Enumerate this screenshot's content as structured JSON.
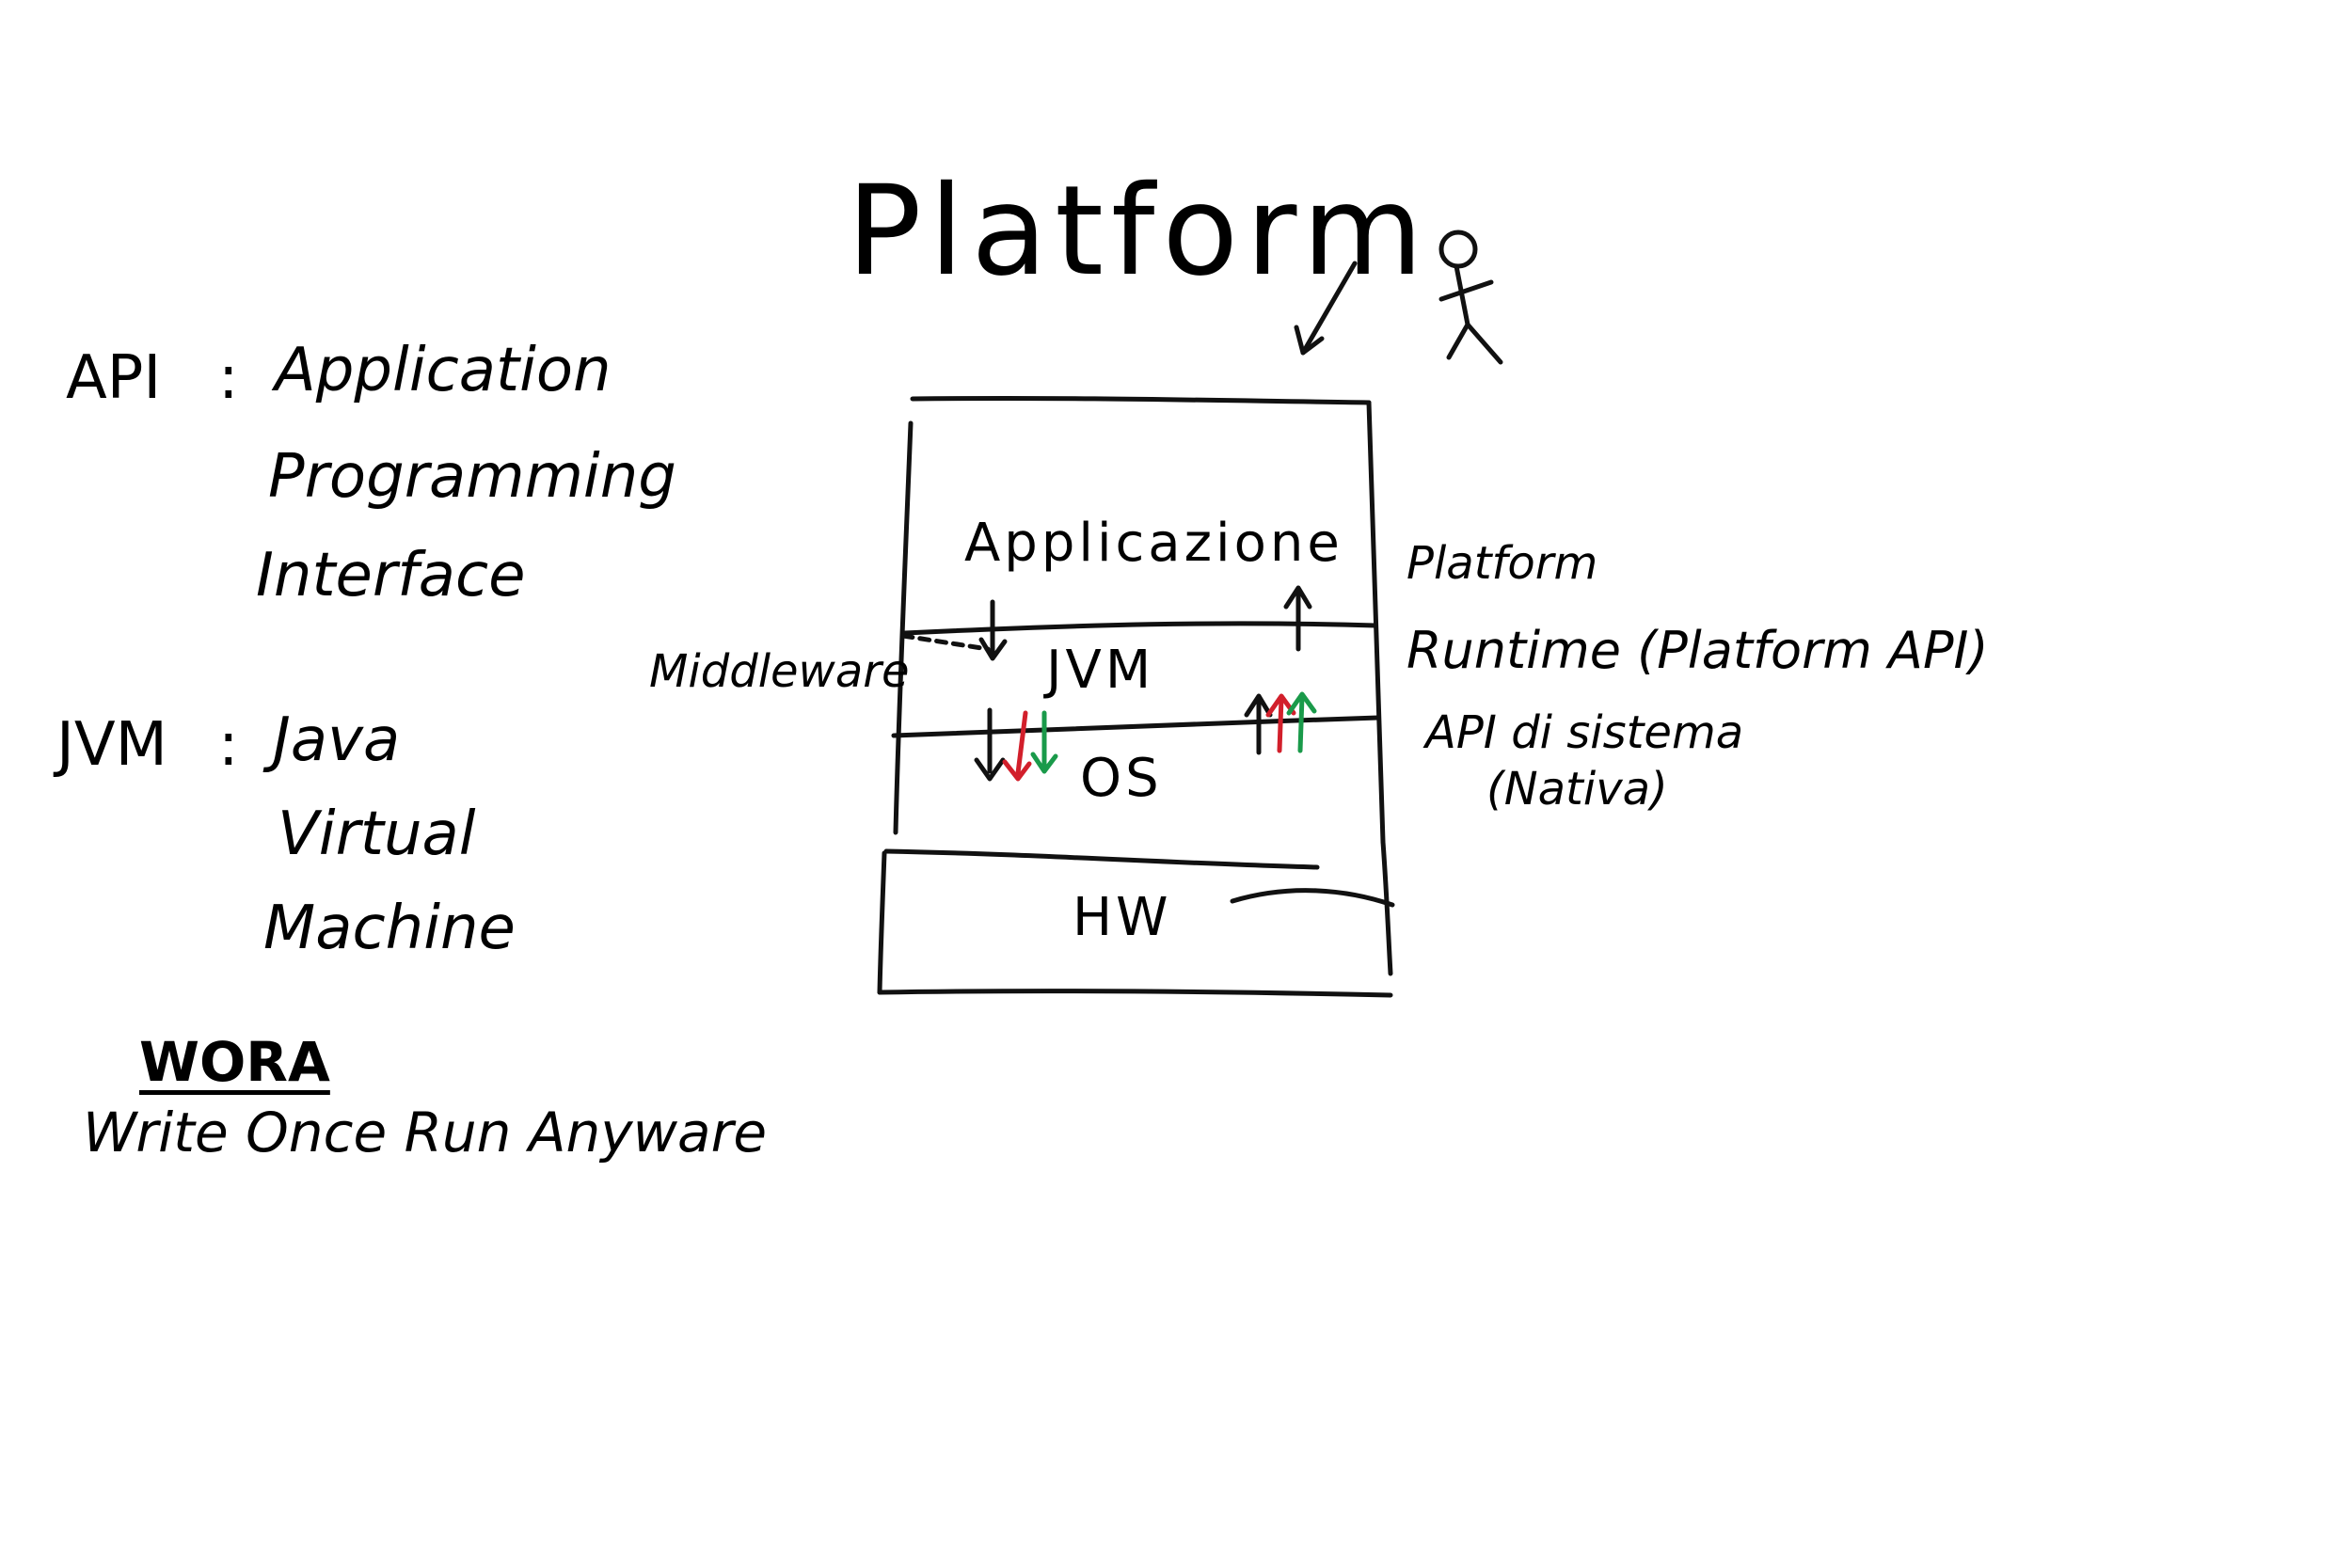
{
  "title": "Platform",
  "definitions": {
    "api": {
      "abbr": "API",
      "sep": ":",
      "lines": [
        "Application",
        "Programming",
        "Interface"
      ]
    },
    "jvm": {
      "abbr": "JVM",
      "sep": ":",
      "lines": [
        "Java",
        "Virtual",
        "Machine"
      ]
    },
    "wora": {
      "abbr": "WORA",
      "full": "Write Once Run Anyware"
    }
  },
  "stack": {
    "layers": [
      "Applicazione",
      "JVM",
      "OS",
      "HW"
    ],
    "left_label": "Middleware",
    "right_labels": {
      "platform": "Platform",
      "runtime": "Runtime (Platform API)",
      "system_api": "API di sistema",
      "native": "(Nativa)"
    }
  },
  "colors": {
    "ink": "#111111",
    "red": "#d21f2b",
    "green": "#1a9a4a"
  }
}
